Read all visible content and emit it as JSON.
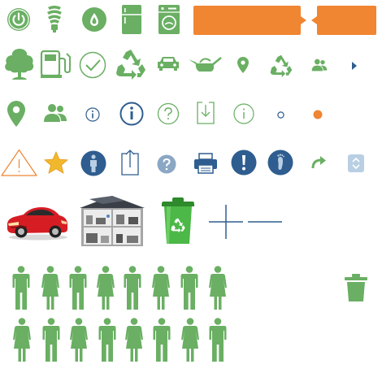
{
  "sprite_sheet": {
    "colors": {
      "green": "#6aaf63",
      "orange": "#f08532",
      "navy": "#2f5d8f",
      "steel": "#8aa7c4",
      "light_blue": "#b9cfe3",
      "gold": "#f2b82d",
      "red": "#d61d24"
    },
    "rows": [
      {
        "row": 1,
        "icons": [
          "power-icon",
          "light-bulb-icon",
          "water-drop-icon",
          "refrigerator-icon",
          "washing-machine-icon",
          "orange-callout-box",
          "orange-callout-box-left"
        ]
      },
      {
        "row": 2,
        "icons": [
          "tree-icon",
          "fuel-pump-icon",
          "check-circle-icon",
          "recycle-icon",
          "car-icon",
          "watering-can-icon",
          "map-pin-small-icon",
          "recycle-small-icon",
          "users-small-icon",
          "caret-right-icon"
        ]
      },
      {
        "row": 3,
        "icons": [
          "map-pin-icon",
          "users-icon",
          "info-small-icon",
          "info-icon",
          "help-icon",
          "download-icon",
          "info-light-icon",
          "dot-outline-icon",
          "dot-orange-icon"
        ]
      },
      {
        "row": 4,
        "icons": [
          "warning-icon",
          "star-icon",
          "person-info-icon",
          "upload-icon",
          "help-gray-icon",
          "printer-icon",
          "alert-icon",
          "footprint-icon",
          "redo-arrow-icon",
          "sort-icon"
        ]
      },
      {
        "row": 5,
        "icons": [
          "red-car-image",
          "house-image",
          "recycle-bin-image",
          "crosshair-plus-icon",
          "minus-line-icon"
        ]
      },
      {
        "row": 6,
        "icons": [
          "person-grid",
          "trash-icon"
        ]
      }
    ],
    "people_grid": {
      "row_1": [
        "male",
        "female",
        "male",
        "female",
        "male",
        "female",
        "male",
        "female"
      ],
      "row_2": [
        "female",
        "male",
        "female",
        "male",
        "female",
        "male",
        "female",
        "male"
      ]
    }
  }
}
